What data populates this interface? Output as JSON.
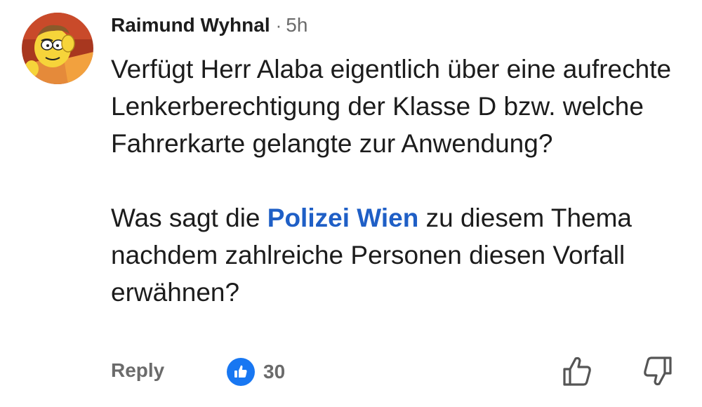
{
  "comment": {
    "author": "Raimund Wyhnal",
    "separator": "·",
    "time": "5h",
    "paragraph1": "Verfügt Herr Alaba eigentlich über eine aufrechte Lenkerberechtigung der Klasse D bzw. welche Fahrerkarte gelangte zur Anwendung?",
    "paragraph2_before": "Was sagt die ",
    "paragraph2_mention": "Polizei Wien",
    "paragraph2_after": " zu diesem Thema nachdem zahlreiche Personen diesen Vorfall erwähnen?"
  },
  "actions": {
    "reply_label": "Reply",
    "like_count": "30"
  },
  "colors": {
    "mention": "#1f5fc6",
    "like_badge": "#1877f2",
    "muted_text": "#6b6b6b"
  },
  "icons": {
    "avatar": "cartoon-avatar",
    "reaction": "thumbs-up-icon",
    "like_action": "thumb-up-outline-icon",
    "dislike_action": "thumb-down-outline-icon"
  }
}
